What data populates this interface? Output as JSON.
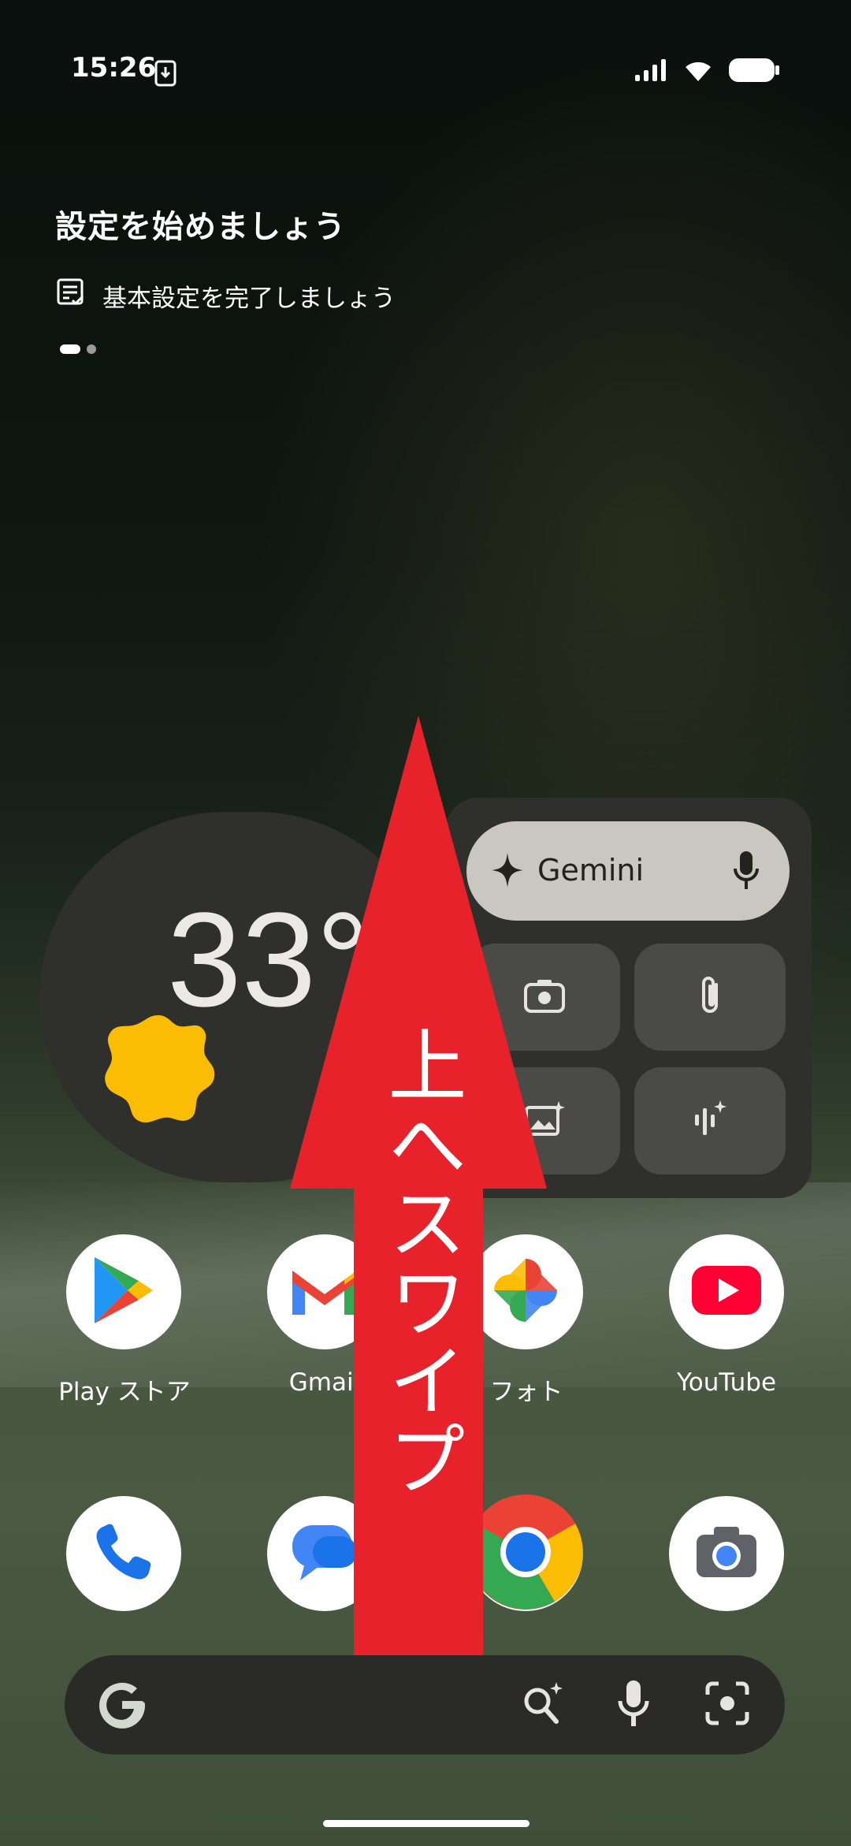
{
  "status_bar": {
    "time": "15:26"
  },
  "setup": {
    "title": "設定を始めましょう",
    "item": "基本設定を完了しましょう"
  },
  "weather": {
    "temperature": "33°",
    "icon": "sun-icon"
  },
  "gemini": {
    "label": "Gemini"
  },
  "apps_row1": [
    {
      "label": "Play ストア",
      "icon": "play-store-icon"
    },
    {
      "label": "Gmail",
      "icon": "gmail-icon"
    },
    {
      "label": "フォト",
      "icon": "photos-icon"
    },
    {
      "label": "YouTube",
      "icon": "youtube-icon"
    }
  ],
  "apps_row2": [
    {
      "icon": "phone-icon"
    },
    {
      "icon": "messages-icon"
    },
    {
      "icon": "chrome-icon"
    },
    {
      "icon": "camera-icon"
    }
  ],
  "overlay": {
    "text": "上へスワイプ"
  },
  "colors": {
    "arrow": "#e8222a",
    "sun": "#fbbc04"
  }
}
